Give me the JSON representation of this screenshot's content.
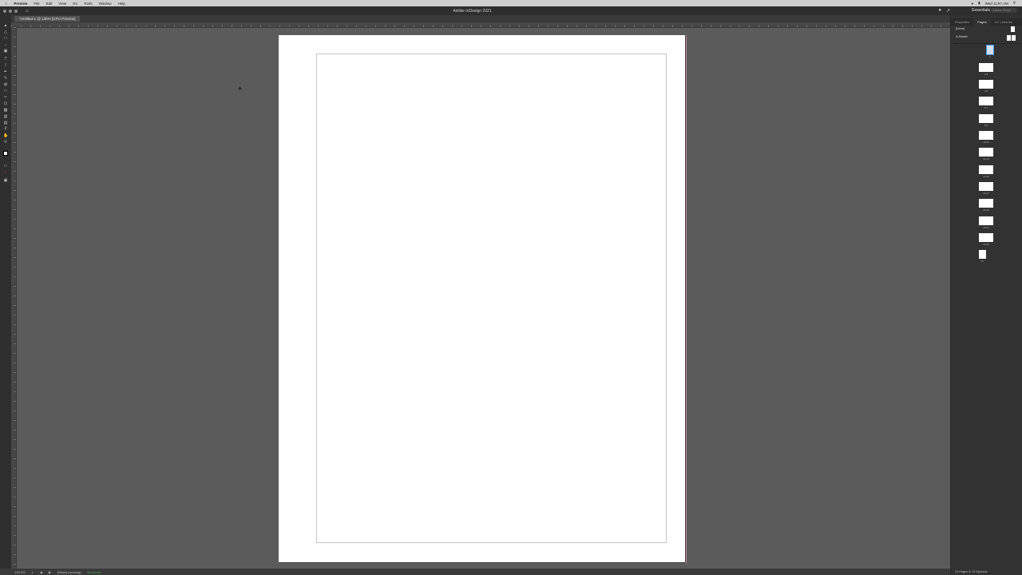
{
  "menubar": {
    "app": "Preview",
    "items": [
      "File",
      "Edit",
      "View",
      "Go",
      "Tools",
      "Window",
      "Help"
    ],
    "clock": "Wed 11:57 AM"
  },
  "window": {
    "title": "Adobe InDesign 2021",
    "workspace": "Essentials",
    "search_placeholder": "Adobe Stock"
  },
  "document_tab": {
    "label": "*Untitled-1 @ 135% [GPU Preview]"
  },
  "tools": [
    "selection",
    "direct-selection",
    "page",
    "gap",
    "content-collector",
    "type",
    "line",
    "pen",
    "pencil",
    "rectangle-frame",
    "rectangle",
    "scissors",
    "free-transform",
    "gradient-swatch",
    "gradient-feather",
    "note",
    "eyedropper",
    "hand",
    "zoom"
  ],
  "statusbar": {
    "zoom": "135.5%",
    "page": "1",
    "style": "[Basic] (working)",
    "preflight": "No errors"
  },
  "panel": {
    "tabs": [
      "Properties",
      "Pages",
      "CC Libraries"
    ],
    "active_tab": "Pages",
    "none_label": "[None]",
    "master_label": "A-Master",
    "pages": [
      {
        "label": "1"
      },
      {
        "label": "2-3"
      },
      {
        "label": "4-5"
      },
      {
        "label": "6-7"
      },
      {
        "label": "8-9"
      },
      {
        "label": "10-11"
      },
      {
        "label": "12-13"
      },
      {
        "label": "14-15"
      },
      {
        "label": "16-17"
      },
      {
        "label": "18-19"
      },
      {
        "label": "20-21"
      },
      {
        "label": "22-23"
      },
      {
        "label": "24"
      }
    ],
    "footer": "24 Pages in 13 Spreads"
  }
}
